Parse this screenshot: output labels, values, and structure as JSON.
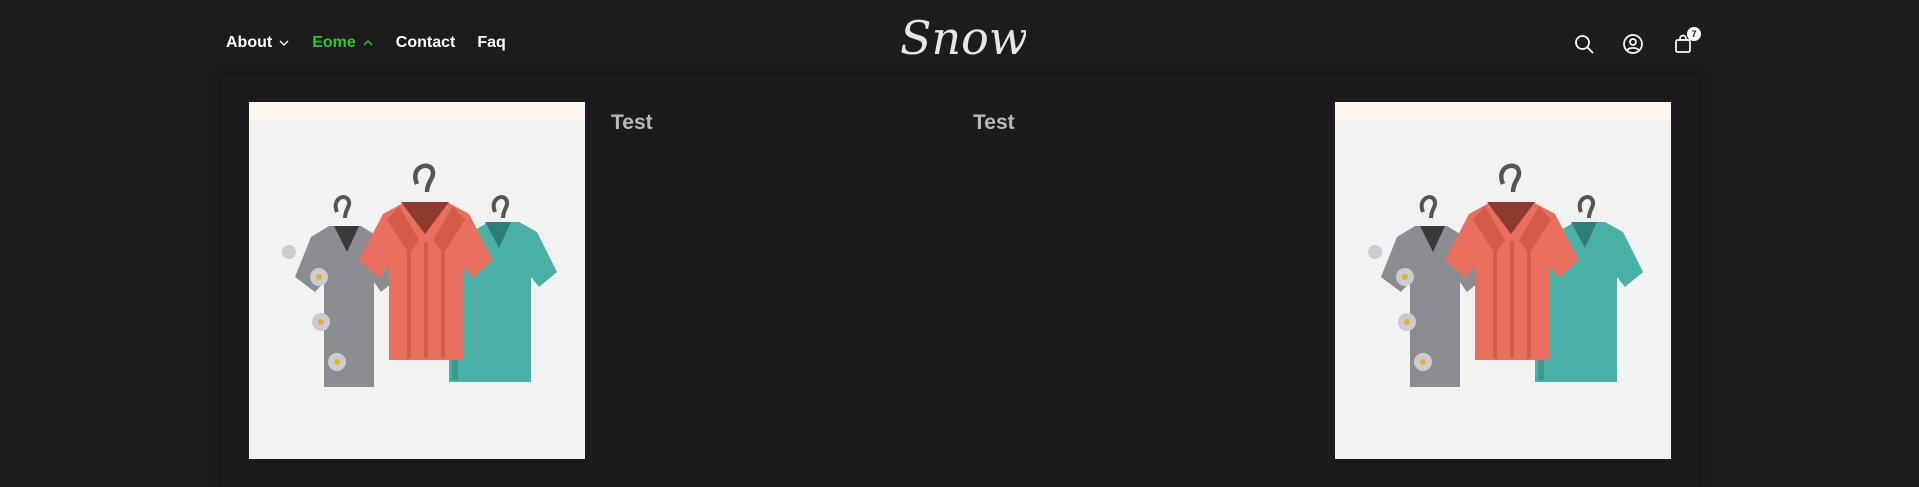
{
  "brand": {
    "logo_text": "Snow"
  },
  "nav": {
    "items": [
      {
        "label": "About",
        "has_dropdown": true,
        "expanded": false
      },
      {
        "label": "Eome",
        "has_dropdown": true,
        "expanded": true
      },
      {
        "label": "Contact",
        "has_dropdown": false
      },
      {
        "label": "Faq",
        "has_dropdown": false
      }
    ]
  },
  "header_icons": {
    "search": "search-icon",
    "account": "user-circle-icon",
    "cart": "shopping-bag-icon",
    "cart_count": "7"
  },
  "mega_menu": {
    "columns": [
      {
        "type": "image",
        "image": "hanging-shirts"
      },
      {
        "type": "heading",
        "title": "Test"
      },
      {
        "type": "heading",
        "title": "Test"
      },
      {
        "type": "image",
        "image": "hanging-shirts"
      }
    ]
  },
  "colors": {
    "background": "#1c1c1c",
    "active_nav": "#2ec72e",
    "heading": "#b8b8b8",
    "image_bg": "#f2f2f2"
  }
}
